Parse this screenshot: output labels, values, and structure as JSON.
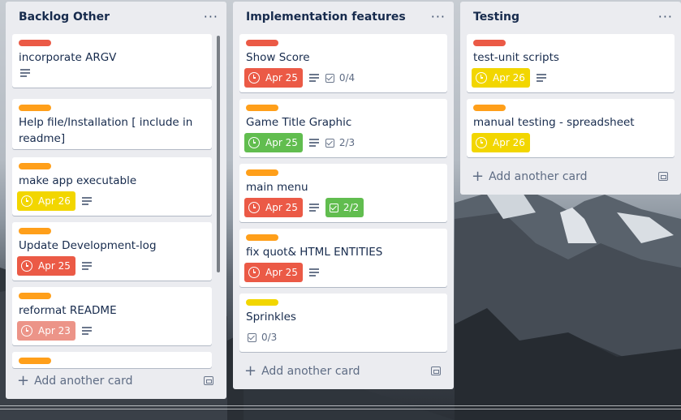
{
  "lists": [
    {
      "title": "Backlog Other",
      "menu": "···",
      "add_label": "Add another card",
      "cards": [
        {
          "label_color": "#eb5a46",
          "title": "incorporate ARGV",
          "due": null,
          "due_color": null,
          "desc": true,
          "checklist": null
        },
        {
          "label_color": "#ff9f1a",
          "title": "Help file/Installation [ include in readme]",
          "due": null,
          "due_color": null,
          "desc": false,
          "checklist": null
        },
        {
          "label_color": "#ff9f1a",
          "title": "make app executable",
          "due": "Apr 26",
          "due_color": "yellow",
          "desc": true,
          "checklist": null
        },
        {
          "label_color": "#ff9f1a",
          "title": "Update Development-log",
          "due": "Apr 25",
          "due_color": "red",
          "desc": true,
          "checklist": null
        },
        {
          "label_color": "#ff9f1a",
          "title": "reformat README",
          "due": "Apr 23",
          "due_color": "pink",
          "desc": true,
          "checklist": null
        },
        {
          "label_color": "#ff9f1a",
          "title": "",
          "due": null,
          "due_color": null,
          "desc": false,
          "checklist": null
        }
      ]
    },
    {
      "title": "Implementation features",
      "menu": "···",
      "add_label": "Add another card",
      "cards": [
        {
          "label_color": "#eb5a46",
          "title": "Show Score",
          "due": "Apr 25",
          "due_color": "red",
          "desc": true,
          "checklist": "0/4",
          "checklist_done": false
        },
        {
          "label_color": "#ff9f1a",
          "title": "Game Title Graphic",
          "due": "Apr 25",
          "due_color": "green",
          "desc": true,
          "checklist": "2/3",
          "checklist_done": false
        },
        {
          "label_color": "#ff9f1a",
          "title": "main menu",
          "due": "Apr 25",
          "due_color": "red",
          "desc": true,
          "checklist": "2/2",
          "checklist_done": true
        },
        {
          "label_color": "#ff9f1a",
          "title": "fix quot& HTML ENTITIES",
          "due": "Apr 25",
          "due_color": "red",
          "desc": true,
          "checklist": null
        },
        {
          "label_color": "#f2d600",
          "title": "Sprinkles",
          "due": null,
          "due_color": null,
          "desc": false,
          "checklist": "0/3",
          "checklist_done": false
        }
      ]
    },
    {
      "title": "Testing",
      "menu": "···",
      "add_label": "Add another card",
      "cards": [
        {
          "label_color": "#eb5a46",
          "title": "test-unit scripts",
          "due": "Apr 26",
          "due_color": "yellow",
          "desc": true,
          "checklist": null
        },
        {
          "label_color": "#ff9f1a",
          "title": "manual testing - spreadsheet",
          "due": "Apr 26",
          "due_color": "yellow",
          "desc": false,
          "checklist": null
        }
      ]
    }
  ]
}
